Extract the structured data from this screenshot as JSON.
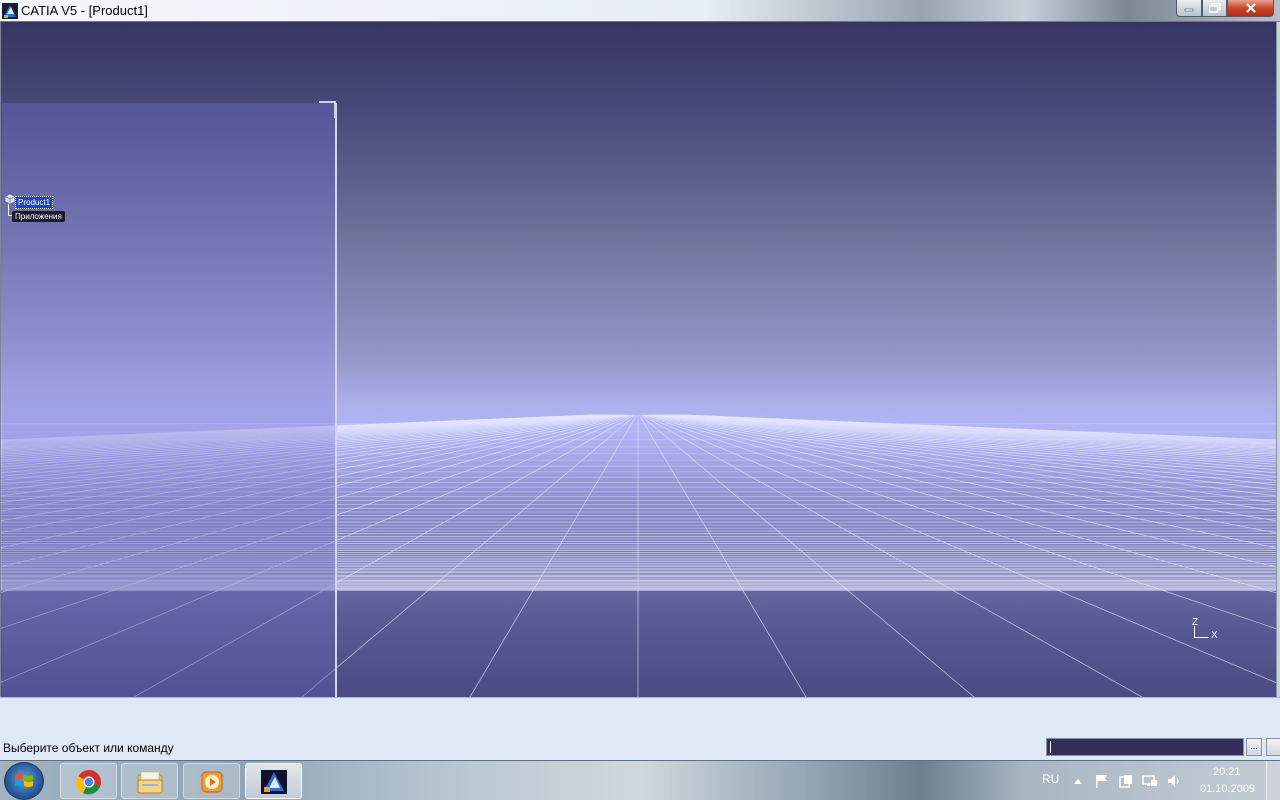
{
  "window": {
    "title": "CATIA V5 - [Product1]"
  },
  "spec_tree": {
    "root_label": "Product1",
    "child_label": "Приложения"
  },
  "axis": {
    "z": "Z",
    "x": "X"
  },
  "status_bar": {
    "message": "Выберите объект или команду",
    "command_value": "",
    "more_label": "..."
  },
  "taskbar": {
    "apps": [
      "chrome-icon",
      "file-explorer-icon",
      "media-player-icon",
      "catia-icon"
    ],
    "language": "RU",
    "time": "20:21",
    "date": "01.10.2009"
  },
  "colors": {
    "selected_tree_item": "#1e45c8",
    "viewport_top": "#353462",
    "viewport_horizon": "#b2b5f5"
  }
}
